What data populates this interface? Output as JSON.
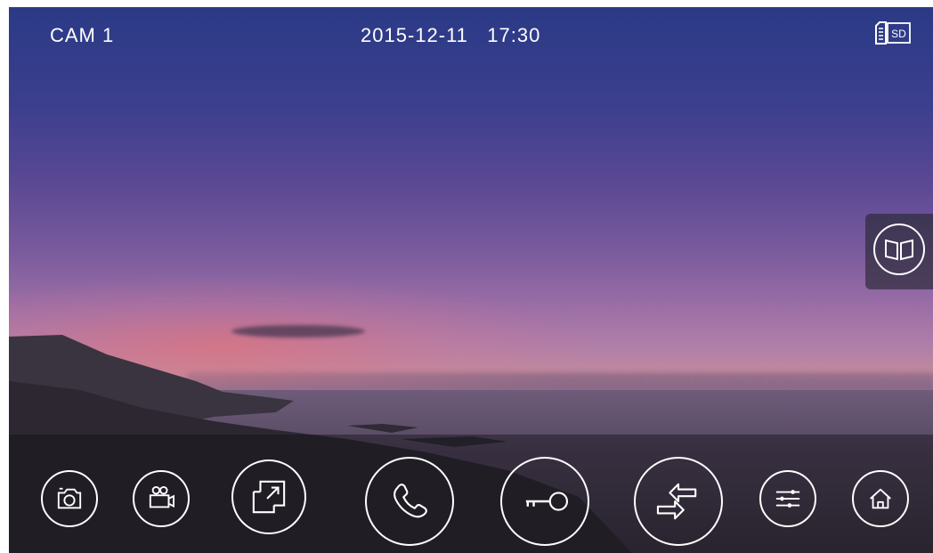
{
  "status_bar": {
    "camera": "CAM 1",
    "date": "2015-12-11",
    "time": "17:30",
    "storage_badge": "SD"
  },
  "side_panel": {
    "phonebook_icon": "book-icon"
  },
  "toolbar": {
    "buttons": [
      {
        "icon": "camera-icon",
        "action": "snapshot"
      },
      {
        "icon": "video-camera-icon",
        "action": "record"
      },
      {
        "icon": "expand-window-icon",
        "action": "fullscreen"
      },
      {
        "icon": "phone-icon",
        "action": "talk"
      },
      {
        "icon": "key-icon",
        "action": "unlock"
      },
      {
        "icon": "switch-arrows-icon",
        "action": "transfer"
      },
      {
        "icon": "sliders-icon",
        "action": "settings"
      },
      {
        "icon": "home-icon",
        "action": "home"
      }
    ]
  },
  "colors": {
    "icon_stroke": "#ffffff",
    "panel_bg": "#28283280"
  }
}
